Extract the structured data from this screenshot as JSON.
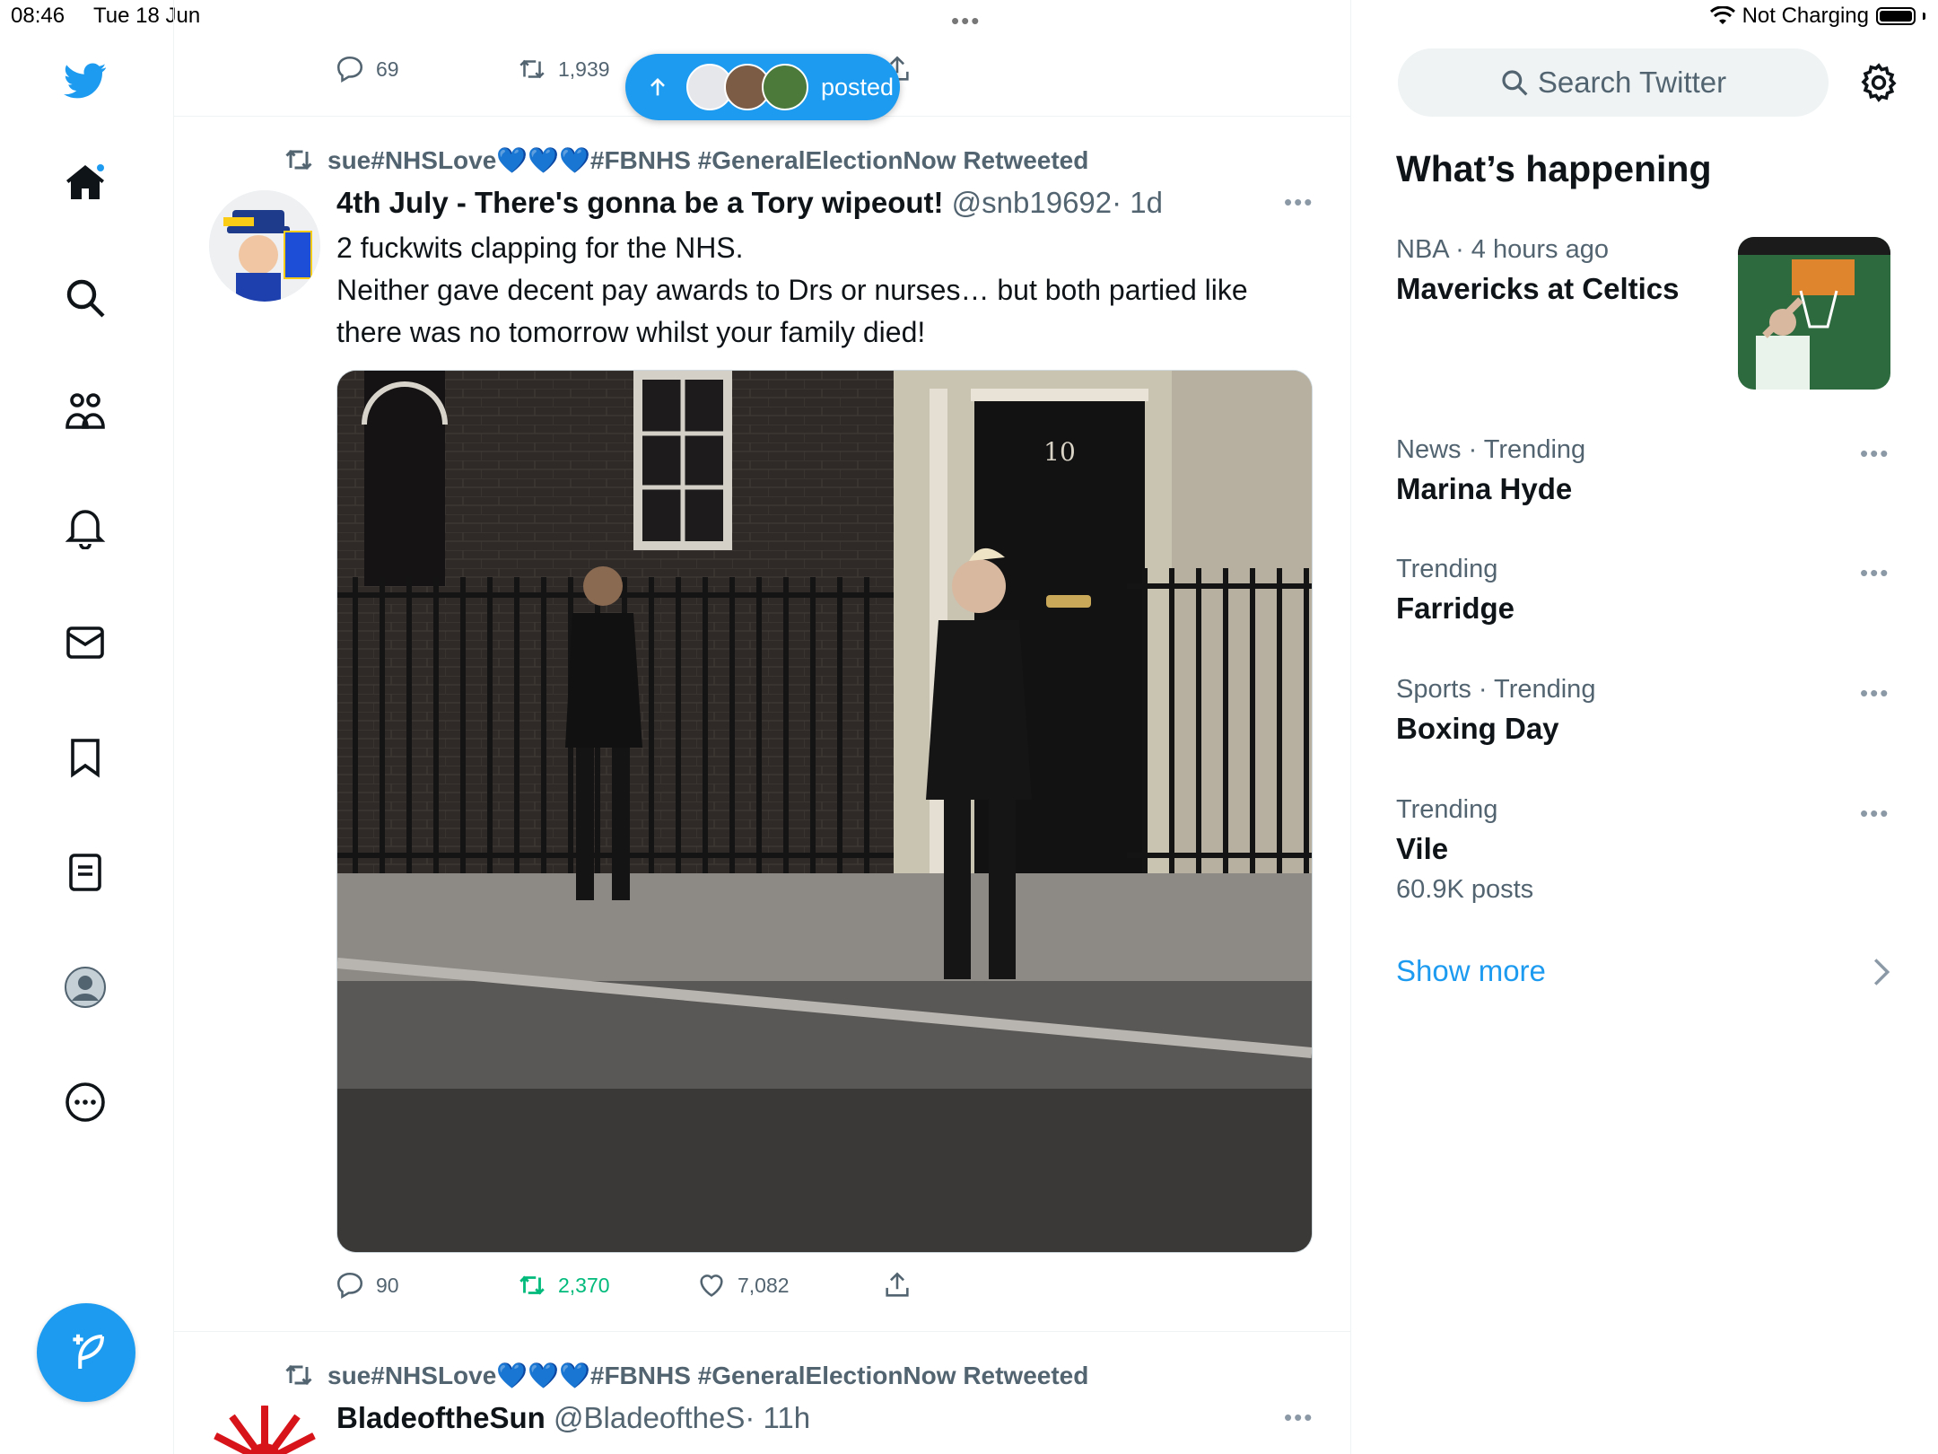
{
  "status_bar": {
    "time": "08:46",
    "date": "Tue 18 Jun",
    "network": "Not Charging",
    "multitask_dots": "•••"
  },
  "nav": {
    "icons": [
      "twitter-logo-icon",
      "home-icon",
      "search-icon",
      "communities-icon",
      "notifications-icon",
      "messages-icon",
      "bookmarks-icon",
      "lists-icon",
      "profile-icon",
      "more-icon"
    ],
    "compose": "compose-icon",
    "brand_color": "#1d9bf0"
  },
  "timeline": {
    "prev_tweet": {
      "replies": "69",
      "retweets": "1,939"
    },
    "new_posts_pill": {
      "label": "posted"
    },
    "tweets": [
      {
        "retweeted_by": "sue#NHSLove💙💙💙#FBNHS #GeneralElectionNow Retweeted",
        "name": "4th July - There's gonna be a Tory wipeout!",
        "handle": "@snb19692",
        "time": "· 1d",
        "text_line1": "2 fuckwits clapping for the NHS.",
        "text_line2": "Neither gave decent pay awards to Drs or nurses… but both partied like there was no tomorrow whilst your family died!",
        "media_door_number": "10",
        "replies": "90",
        "retweets": "2,370",
        "likes": "7,082",
        "retweet_active_color": "#00ba7c"
      },
      {
        "retweeted_by": "sue#NHSLove💙💙💙#FBNHS #GeneralElectionNow Retweeted",
        "name": "BladeoftheSun",
        "handle": "@BladeoftheS",
        "time": "· 11h"
      }
    ]
  },
  "sidebar": {
    "search_placeholder": "Search Twitter",
    "section_title": "What’s happening",
    "trends": [
      {
        "meta": "NBA · 4 hours ago",
        "title": "Mavericks at Celtics",
        "count": ""
      },
      {
        "meta": "News · Trending",
        "title": "Marina Hyde",
        "count": ""
      },
      {
        "meta": "Trending",
        "title": "Farridge",
        "count": ""
      },
      {
        "meta": "Sports · Trending",
        "title": "Boxing Day",
        "count": ""
      },
      {
        "meta": "Trending",
        "title": "Vile",
        "count": "60.9K posts"
      }
    ],
    "show_more": "Show more"
  }
}
